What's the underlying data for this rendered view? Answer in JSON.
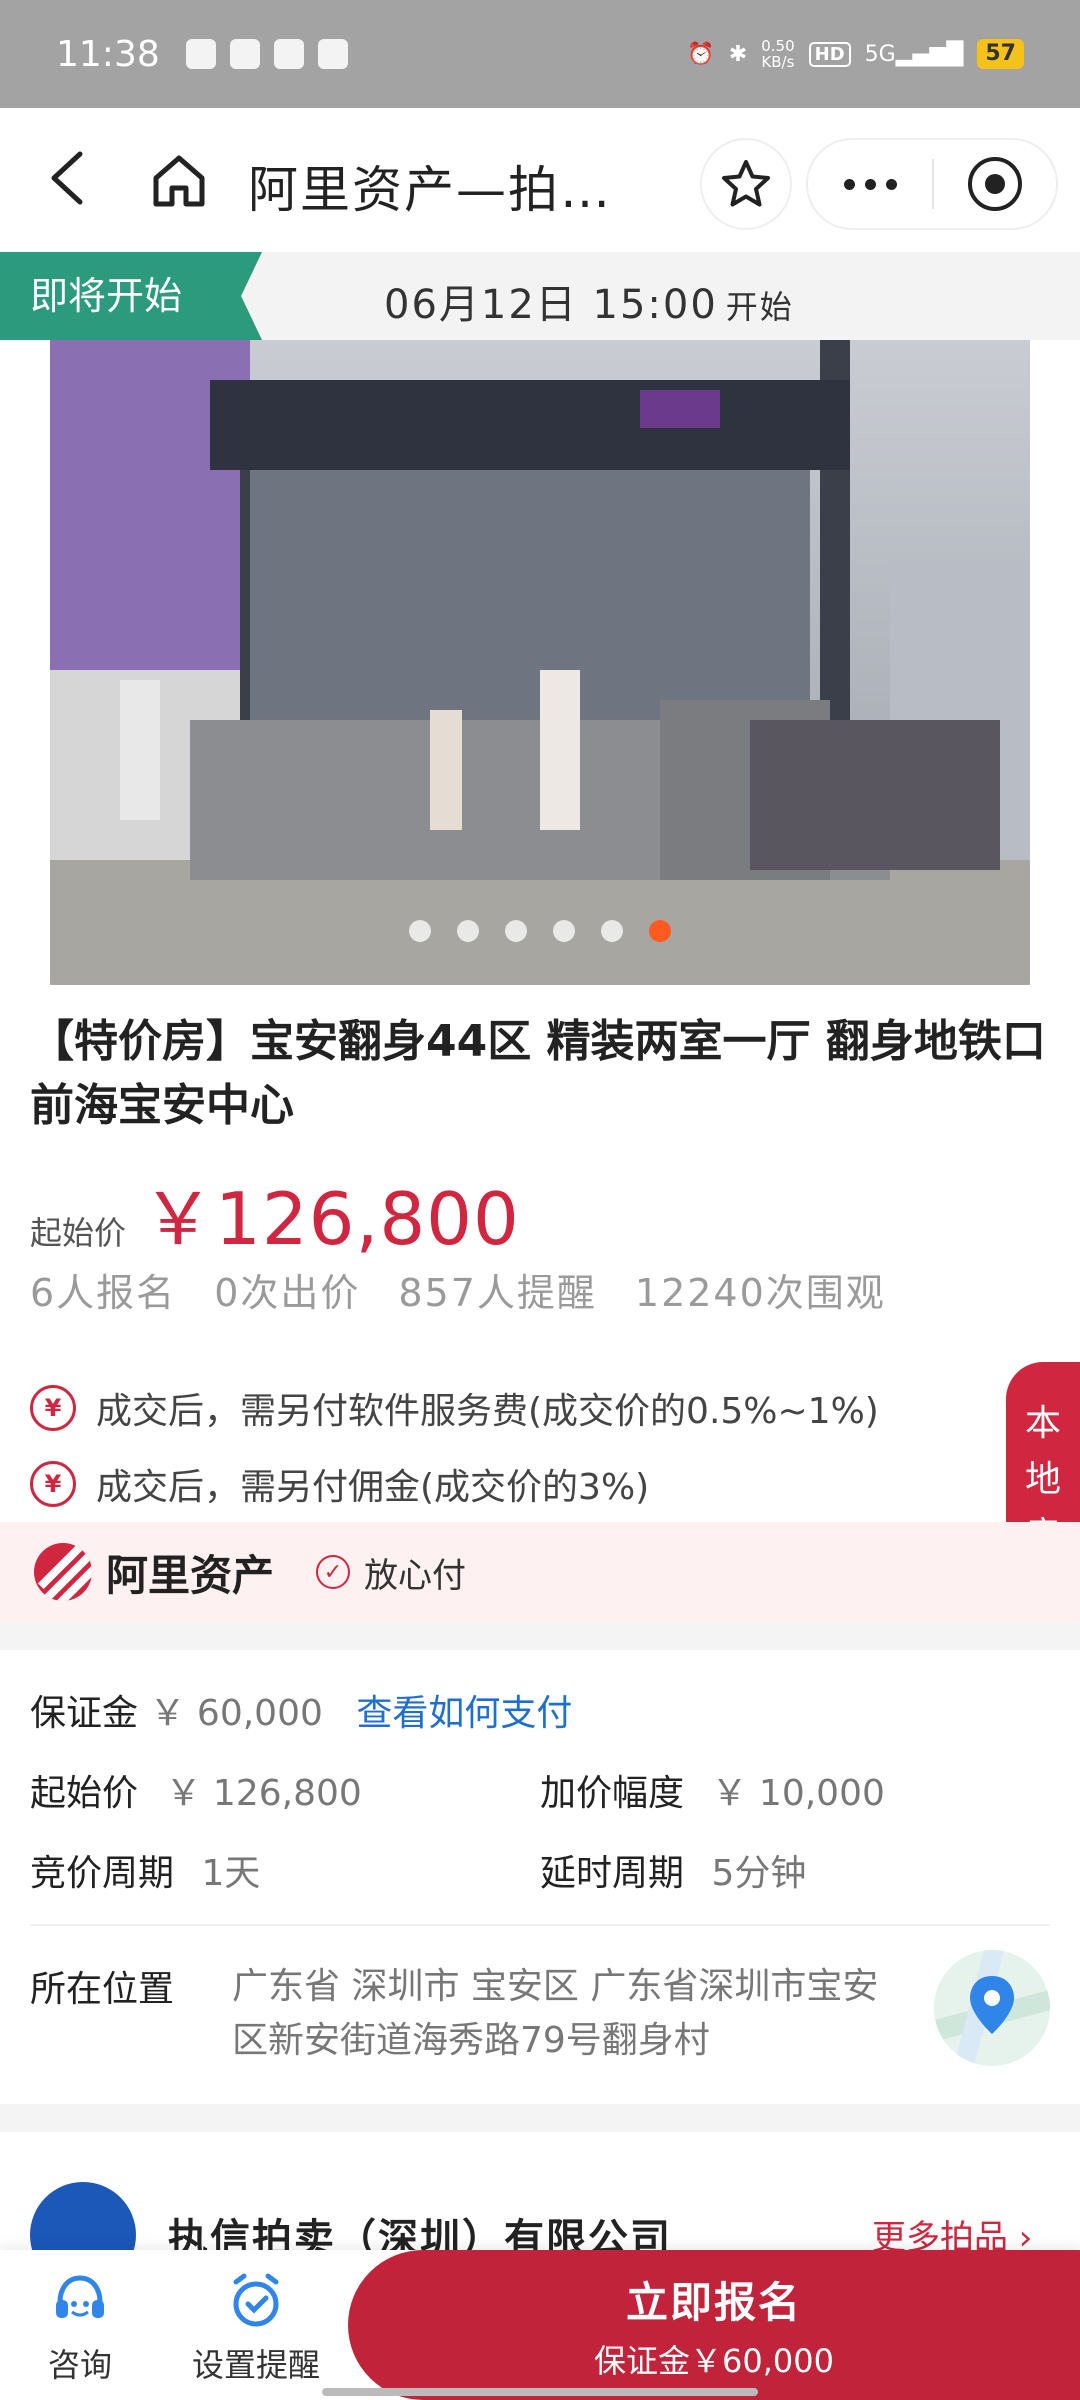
{
  "status_bar": {
    "time": "11:38",
    "net_speed_top": "0.50",
    "net_speed_bottom": "KB/s",
    "hd": "HD",
    "signal": "5G",
    "battery": "57"
  },
  "nav": {
    "title": "阿里资产—拍…"
  },
  "banner": {
    "tag": "即将开始",
    "start_time": "06月12日 15:00",
    "start_suffix": "开始"
  },
  "gallery": {
    "total": 6,
    "active_index": 5
  },
  "listing": {
    "title": "【特价房】宝安翻身44区 精装两室一厅 翻身地铁口 前海宝安中心",
    "start_price_label": "起始价",
    "start_price": "￥126,800",
    "stats": [
      "6人报名",
      "0次出价",
      "857人提醒",
      "12240次围观"
    ],
    "fees": [
      "成交后，需另付软件服务费(成交价的0.5%~1%)",
      "成交后，需另付佣金(成交价的3%)"
    ],
    "fee_icon": "¥"
  },
  "local_tab": {
    "chars": [
      "本",
      "地",
      "房"
    ]
  },
  "platform": {
    "brand": "阿里资产",
    "guarantee": "放心付"
  },
  "info": {
    "deposit_label": "保证金",
    "deposit_value": "￥ 60,000",
    "deposit_link": "查看如何支付",
    "start_label": "起始价",
    "start_value": "￥ 126,800",
    "increment_label": "加价幅度",
    "increment_value": "￥ 10,000",
    "cycle_label": "竞价周期",
    "cycle_value": "1天",
    "extend_label": "延时周期",
    "extend_value": "5分钟",
    "location_label": "所在位置",
    "location_value": "广东省 深圳市 宝安区 广东省深圳市宝安区新安街道海秀路79号翻身村"
  },
  "company": {
    "name": "执信拍卖（深圳）有限公司",
    "more": "更多拍品 ›"
  },
  "bottom": {
    "consult": "咨询",
    "reminder": "设置提醒",
    "signup": "立即报名",
    "signup_sub": "保证金￥60,000"
  },
  "colors": {
    "accent_red": "#d0263f",
    "button_red": "#c0233a",
    "tag_green": "#2b9a7d",
    "link_blue": "#1f6fd1"
  }
}
